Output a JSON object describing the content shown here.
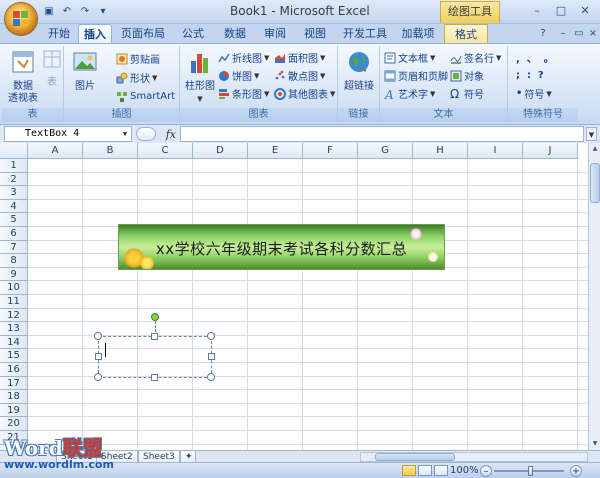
{
  "window": {
    "title": "Book1 - Microsoft Excel",
    "context_header": "绘图工具",
    "controls": [
      "–",
      "□",
      "✕"
    ]
  },
  "qat": {
    "items": [
      "save-icon",
      "undo-icon",
      "redo-icon",
      "customize-icon"
    ]
  },
  "tabs": [
    "开始",
    "插入",
    "页面布局",
    "公式",
    "数据",
    "审阅",
    "视图",
    "开发工具",
    "加载项",
    "格式"
  ],
  "active_tab": "插入",
  "ribbon": {
    "groups": {
      "table": {
        "label": "表",
        "pivot": "数据\n透视表",
        "table_btn": "表"
      },
      "illustrations": {
        "label": "插图",
        "picture": "图片",
        "clipart": "剪贴画",
        "shapes": "形状",
        "smartart": "SmartArt"
      },
      "charts": {
        "label": "图表",
        "column": "柱形图",
        "line": "折线图",
        "pie": "饼图",
        "bar": "条形图",
        "area": "面积图",
        "scatter": "散点图",
        "other": "其他图表"
      },
      "links": {
        "label": "链接",
        "hyperlink": "超链接"
      },
      "text": {
        "label": "文本",
        "textbox": "文本框",
        "header_footer": "页眉和页脚",
        "wordart": "艺术字",
        "signature": "签名行",
        "object": "对象",
        "symbol": "符号"
      },
      "special": {
        "label": "特殊符号",
        "row1": ",  、  。",
        "row2": ";  :  ?",
        "symbol": "符号"
      }
    }
  },
  "formula_bar": {
    "namebox": "TextBox 4",
    "fx": "fx",
    "value": ""
  },
  "grid": {
    "columns": [
      "A",
      "B",
      "C",
      "D",
      "E",
      "F",
      "G",
      "H",
      "I",
      "J"
    ],
    "rows": [
      "1",
      "2",
      "3",
      "4",
      "5",
      "6",
      "7",
      "8",
      "9",
      "10",
      "11",
      "12",
      "13",
      "14",
      "15",
      "16",
      "17",
      "18",
      "19",
      "20",
      "21",
      "22"
    ]
  },
  "banner": {
    "text": "xx学校六年级期末考试各科分数汇总"
  },
  "textbox": {
    "name": "TextBox 4",
    "content": ""
  },
  "sheets": [
    "Sheet1",
    "Sheet2",
    "Sheet3"
  ],
  "status": {
    "zoom": "100%"
  },
  "watermark": {
    "brand_a": "Word",
    "brand_b": "联盟",
    "url": "www.wordlm.com"
  },
  "colors": {
    "ribbon_bg": "#dbe7f7",
    "accent": "#15428b",
    "context_tab": "#f0cf5b",
    "grid_line": "#d4dce8"
  }
}
